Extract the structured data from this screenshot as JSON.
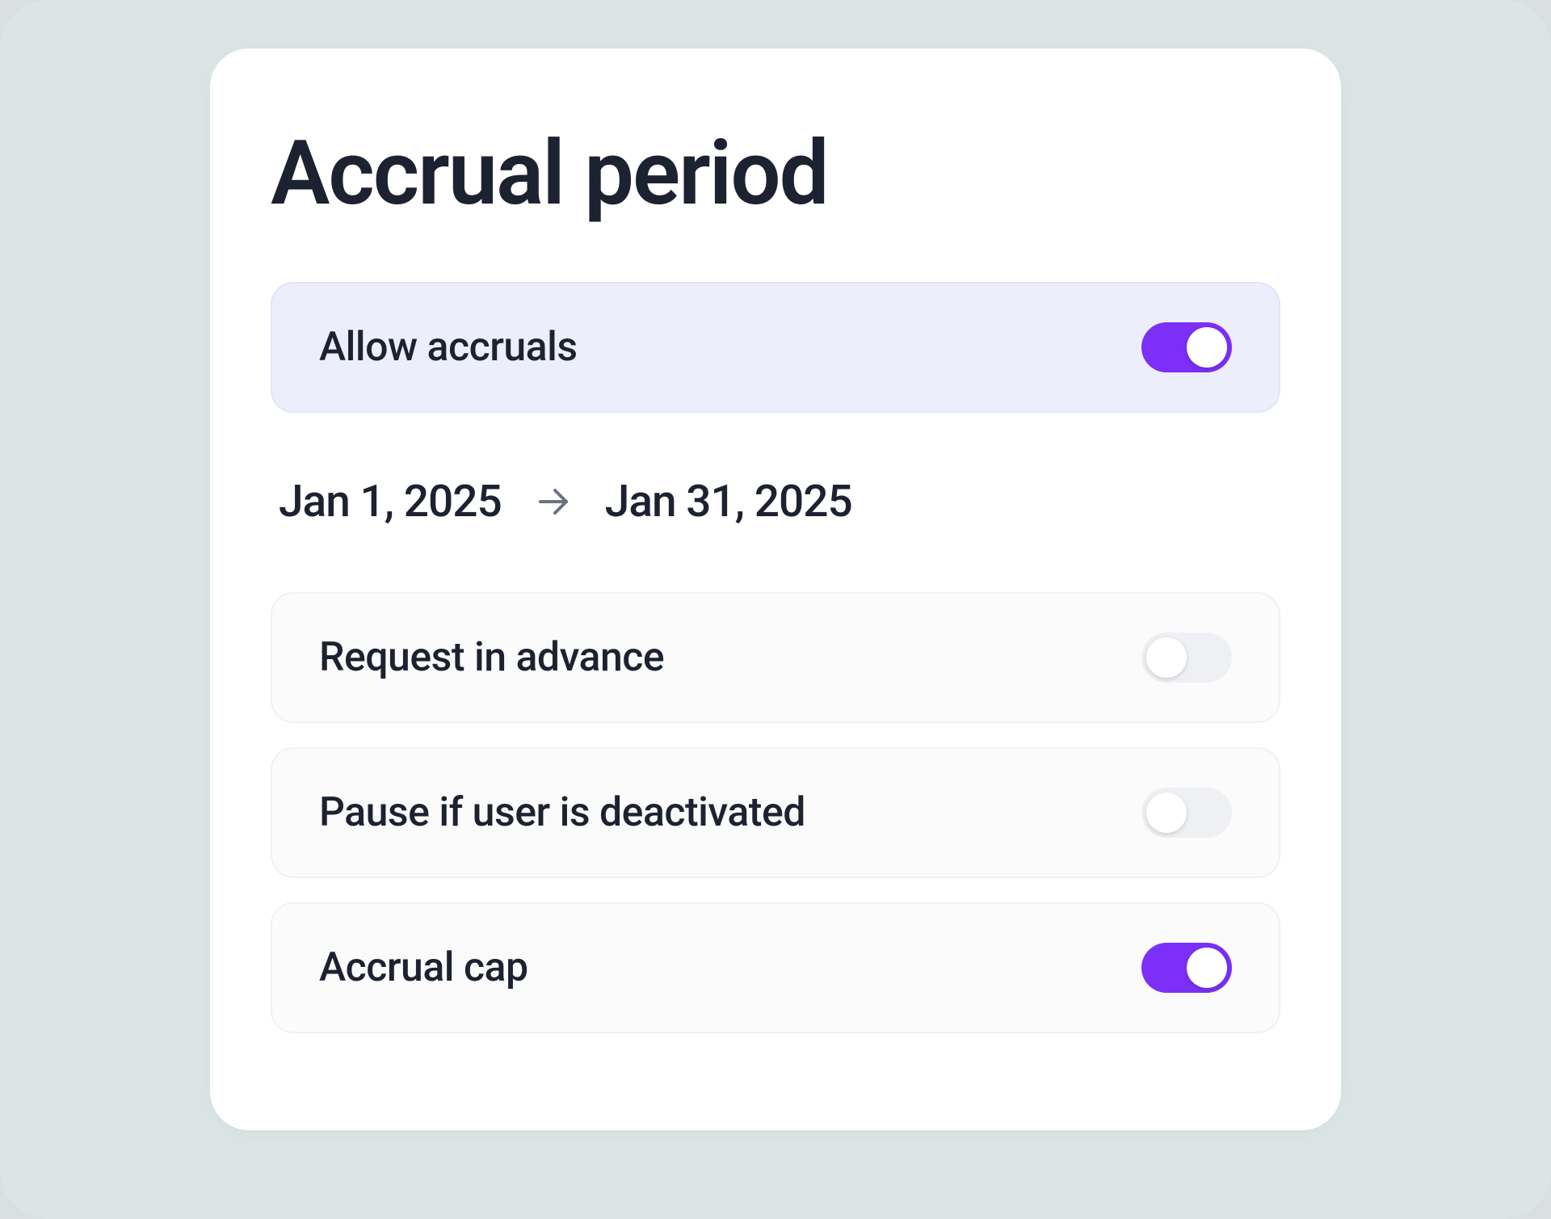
{
  "title": "Accrual period",
  "settings": {
    "allow_accruals": {
      "label": "Allow accruals",
      "enabled": true
    },
    "request_in_advance": {
      "label": "Request in advance",
      "enabled": false
    },
    "pause_if_deactivated": {
      "label": "Pause if user is deactivated",
      "enabled": false
    },
    "accrual_cap": {
      "label": "Accrual cap",
      "enabled": true
    }
  },
  "date_range": {
    "start": "Jan 1, 2025",
    "end": "Jan 31, 2025"
  },
  "colors": {
    "accent": "#7b2ff7",
    "text": "#1d2231",
    "highlighted_bg": "#edeefb",
    "plain_bg": "#fbfbfc"
  }
}
